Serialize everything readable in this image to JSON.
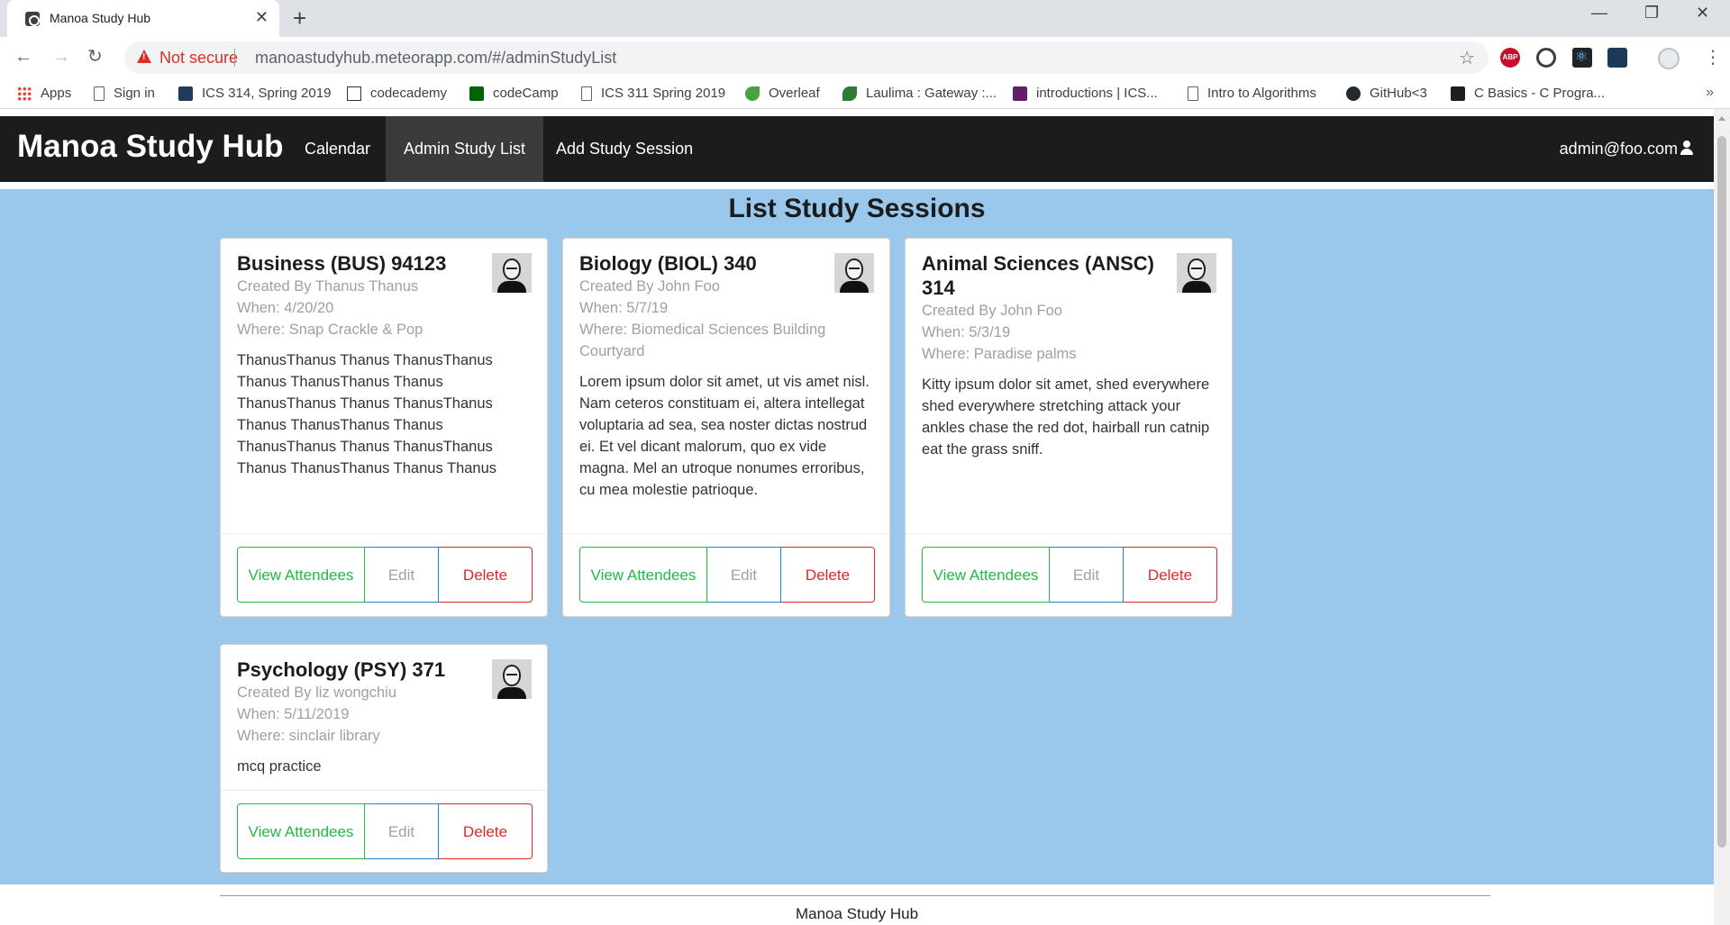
{
  "browser": {
    "tab_title": "Manoa Study Hub",
    "tab_close": "✕",
    "new_tab": "+",
    "window_minimize": "—",
    "window_restore": "❐",
    "window_close": "✕",
    "back_icon": "←",
    "forward_icon": "→",
    "reload_icon": "↻",
    "security_label": "Not secure",
    "url": "manoastudyhub.meteorapp.com/#/adminStudyList",
    "star_icon": "☆",
    "abp_label": "ABP",
    "menu_icon": "⋮",
    "bookmarks_more": "»",
    "bookmarks": [
      {
        "label": "Apps",
        "icon": "apps-icon"
      },
      {
        "label": "Sign in",
        "icon": "page-icon"
      },
      {
        "label": "ICS 314, Spring 2019",
        "icon": "page-icon"
      },
      {
        "label": "codecademy",
        "icon": "codecademy-icon"
      },
      {
        "label": "codeCamp",
        "icon": "codecamp-icon"
      },
      {
        "label": "ICS 311 Spring 2019",
        "icon": "page-icon"
      },
      {
        "label": "Overleaf",
        "icon": "overleaf-icon"
      },
      {
        "label": "Laulima : Gateway :...",
        "icon": "laulima-icon"
      },
      {
        "label": "introductions | ICS...",
        "icon": "slack-icon"
      },
      {
        "label": "Intro to Algorithms",
        "icon": "page-icon"
      },
      {
        "label": "GitHub<3",
        "icon": "github-icon"
      },
      {
        "label": "C Basics - C Progra...",
        "icon": "terminal-icon"
      }
    ]
  },
  "navbar": {
    "brand": "Manoa Study Hub",
    "items": [
      {
        "label": "Calendar",
        "active": false
      },
      {
        "label": "Admin Study List",
        "active": true
      },
      {
        "label": "Add Study Session",
        "active": false
      }
    ],
    "user": "admin@foo.com"
  },
  "page_title": "List Study Sessions",
  "cards": [
    {
      "title": "Business (BUS) 94123",
      "created_by": "Created By Thanus Thanus",
      "when": "When: 4/20/20",
      "where": "Where: Snap Crackle & Pop",
      "description": "ThanusThanus Thanus ThanusThanus Thanus ThanusThanus Thanus ThanusThanus Thanus ThanusThanus Thanus ThanusThanus Thanus ThanusThanus Thanus ThanusThanus Thanus ThanusThanus Thanus Thanus"
    },
    {
      "title": "Biology (BIOL) 340",
      "created_by": "Created By John Foo",
      "when": "When: 5/7/19",
      "where": "Where: Biomedical Sciences Building Courtyard",
      "description": "Lorem ipsum dolor sit amet, ut vis amet nisl. Nam ceteros constituam ei, altera intellegat voluptaria ad sea, sea noster dictas nostrud ei. Et vel dicant malorum, quo ex vide magna. Mel an utroque nonumes erroribus, cu mea molestie patrioque."
    },
    {
      "title": "Animal Sciences (ANSC) 314",
      "created_by": "Created By John Foo",
      "when": "When: 5/3/19",
      "where": "Where: Paradise palms",
      "description": "Kitty ipsum dolor sit amet, shed everywhere shed everywhere stretching attack your ankles chase the red dot, hairball run catnip eat the grass sniff."
    },
    {
      "title": "Psychology (PSY) 371",
      "created_by": "Created By liz wongchiu",
      "when": "When: 5/11/2019",
      "where": "Where: sinclair library",
      "description": "mcq practice"
    }
  ],
  "buttons": {
    "view": "View Attendees",
    "edit": "Edit",
    "delete": "Delete"
  },
  "footer": "Manoa Study Hub",
  "colors": {
    "navbar": "#1b1c1d",
    "background": "#9ac8ec",
    "view_button": "#21ba45",
    "edit_button": "#2185d0",
    "delete_button": "#db2828"
  }
}
